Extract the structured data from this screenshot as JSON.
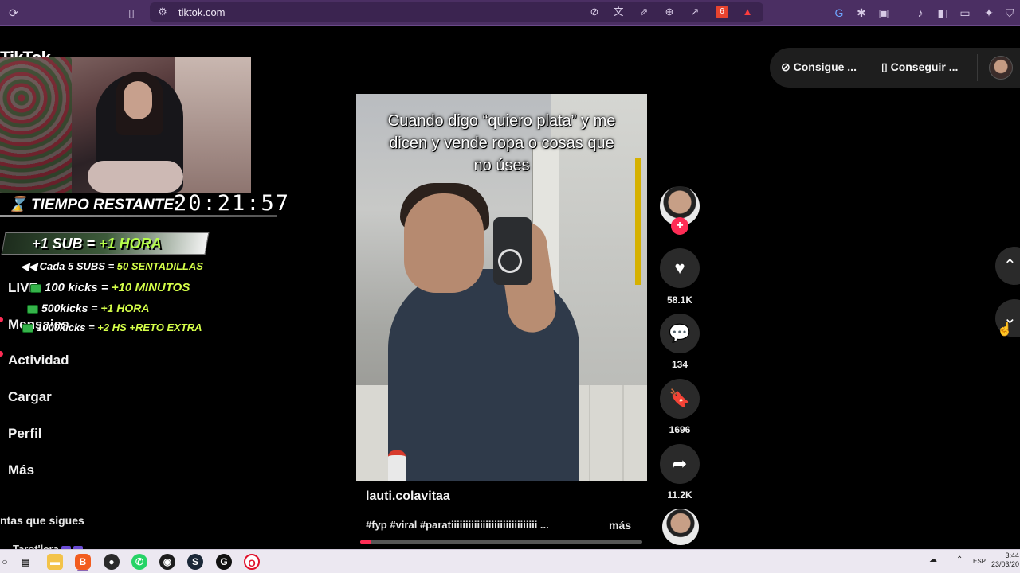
{
  "browser": {
    "url": "tiktok.com",
    "shield_count": "6"
  },
  "sidebar": {
    "logo": "TikTok",
    "items": [
      {
        "label": "LIVE"
      },
      {
        "label": "Mensajes"
      },
      {
        "label": "Actividad"
      },
      {
        "label": "Cargar"
      },
      {
        "label": "Perfil"
      },
      {
        "label": "Más"
      }
    ],
    "following_header": "ntas que sigues",
    "following_user": "Tarot'lera"
  },
  "overlay": {
    "timer_label": "TIEMPO RESTANTE:",
    "timer_value": "20:21:57",
    "sub_rule_a": "+1 SUB = ",
    "sub_rule_b": "+1 HORA",
    "rules": [
      {
        "a": "Cada 5 SUBS = ",
        "b": "50 SENTADILLAS"
      },
      {
        "a": "100 kicks = ",
        "b": "+10 MINUTOS"
      },
      {
        "a": "500kicks = ",
        "b": "+1 HORA"
      },
      {
        "a": "1000kicks = ",
        "b": "+2 HS +RETO EXTRA"
      }
    ]
  },
  "video": {
    "caption": "Cuando digo “quiero plata” y me dicen y vende ropa o cosas que no úses",
    "author": "lauti.colavitaa",
    "hashtags": "#fyp #viral #paratiiiiiiiiiiiiiiiiiiiiiiiiiiiiii ...",
    "more_label": "más",
    "progress": 0.04
  },
  "actions": {
    "likes": "58.1K",
    "comments": "134",
    "saves": "1696",
    "shares": "11.2K"
  },
  "topbar": {
    "coins_label": "Consigue ...",
    "app_label": "Conseguir ..."
  },
  "taskbar": {
    "lang": "ESP",
    "time": "3:44",
    "date": "23/03/20"
  },
  "colors": {
    "accent": "#fe2c55",
    "browser_bar": "#4b2f63",
    "taskbar": "#ece8f1"
  }
}
